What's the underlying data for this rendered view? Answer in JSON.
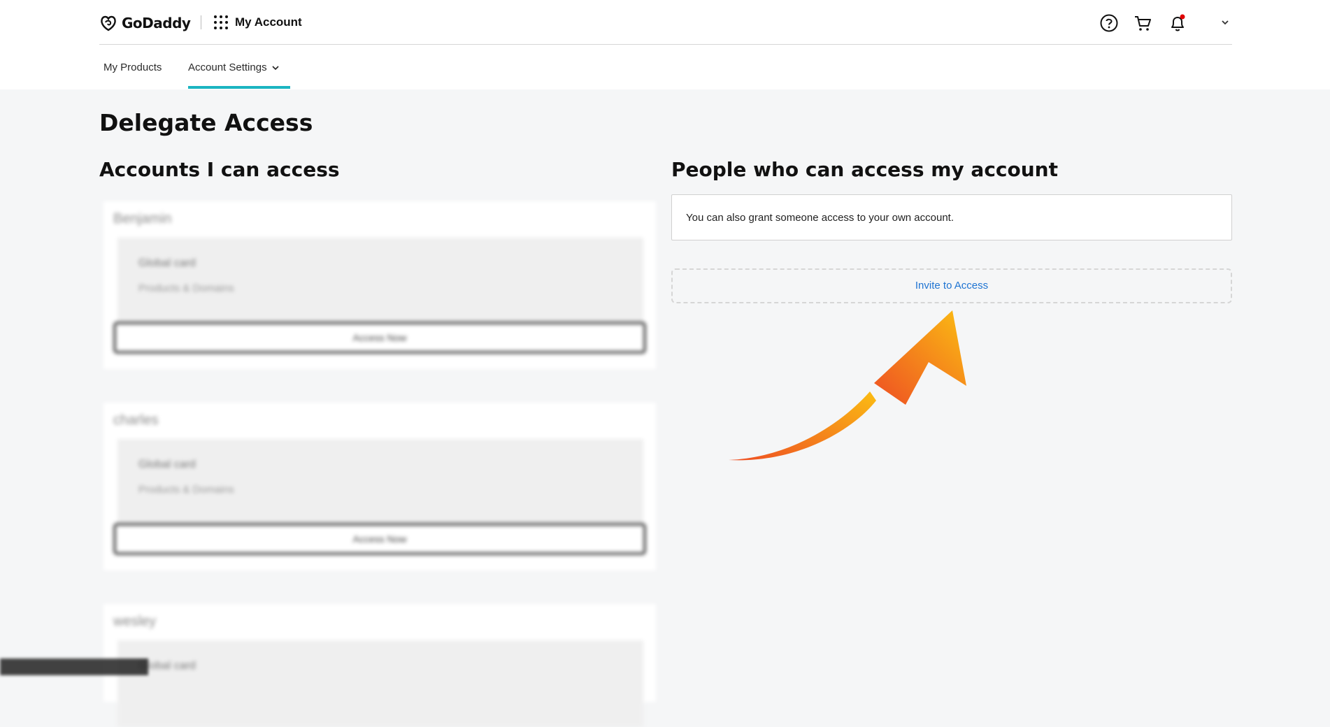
{
  "header": {
    "logo_text": "GoDaddy",
    "app_title": "My Account",
    "icons": [
      "help-icon",
      "cart-icon",
      "bell-icon",
      "chevron-down-icon"
    ],
    "notification_dot_color": "#e00000"
  },
  "nav": {
    "tabs": [
      {
        "label": "My Products"
      },
      {
        "label": "Account Settings"
      }
    ],
    "active_tab": "Account Settings",
    "accent_color": "#1bb5c1"
  },
  "page": {
    "title": "Delegate Access"
  },
  "left_section": {
    "title": "Accounts I can access",
    "accounts": [
      {
        "name": "Benjamin",
        "role": "Global card",
        "detail": "Products & Domains",
        "button": "Access Now"
      },
      {
        "name": "charles",
        "role": "Global card",
        "detail": "Products & Domains",
        "button": "Access Now"
      },
      {
        "name": "wesley",
        "role": "Global card"
      }
    ]
  },
  "right_section": {
    "title": "People who can access my account",
    "info": "You can also grant someone access to your own account.",
    "invite_label": "Invite to Access",
    "link_color": "#1f74d2"
  }
}
